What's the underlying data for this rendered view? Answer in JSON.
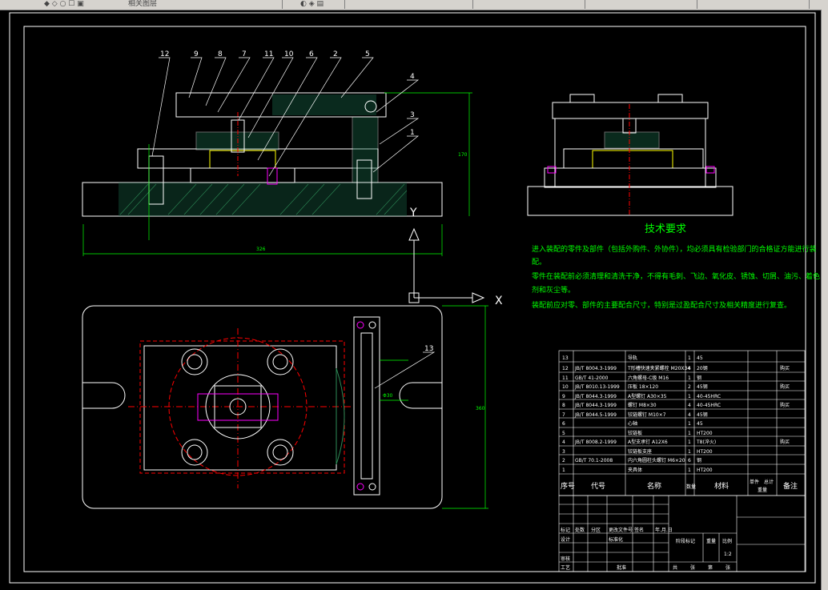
{
  "toolbar": {
    "layer_name": "相关图层"
  },
  "axes": {
    "x_label": "X",
    "y_label": "Y"
  },
  "tech_requirements": {
    "title": "技术要求",
    "lines": [
      "进入装配的零件及部件（包括外购件、外协件），均必须具有检验部门的合格证方能进行装",
      "配。",
      "零件在装配前必须清理和清洗干净，不得有毛刺、飞边、氧化皮、锈蚀、切屑、油污、着色",
      "剂和灰尘等。",
      "装配前应对零、部件的主要配合尺寸，特别是过盈配合尺寸及相关精度进行复查。"
    ]
  },
  "balloons": [
    "12",
    "9",
    "8",
    "7",
    "11",
    "10",
    "6",
    "2",
    "5",
    "4",
    "3",
    "1",
    "13"
  ],
  "bom": {
    "rows": [
      {
        "no": "13",
        "code": "",
        "name": "导轨",
        "qty": "1",
        "material": "45",
        "note": ""
      },
      {
        "no": "12",
        "code": "JB/T 8004.3-1999",
        "name": "T形槽快速夹紧螺栓 M20X34",
        "qty": "4",
        "material": "20钢",
        "note": "购买"
      },
      {
        "no": "11",
        "code": "GB/T 41-2000",
        "name": "六角螺母-C级 M16",
        "qty": "1",
        "material": "钢",
        "note": ""
      },
      {
        "no": "10",
        "code": "JB/T 8010.13-1999",
        "name": "压板 18×120",
        "qty": "2",
        "material": "45钢",
        "note": "购买"
      },
      {
        "no": "9",
        "code": "JB/T 8044.3-1999",
        "name": "A型螺钉 A30×35",
        "qty": "1",
        "material": "40-45HRC",
        "note": ""
      },
      {
        "no": "8",
        "code": "JB/T 8044.3-1999",
        "name": "螺钉 M8×30",
        "qty": "4",
        "material": "40-45HRC",
        "note": "购买"
      },
      {
        "no": "7",
        "code": "JB/T 8044.5-1999",
        "name": "铰链螺钉 M10×7",
        "qty": "4",
        "material": "45钢",
        "note": ""
      },
      {
        "no": "6",
        "code": "",
        "name": "心轴",
        "qty": "1",
        "material": "45",
        "note": ""
      },
      {
        "no": "5",
        "code": "",
        "name": "铰链板",
        "qty": "1",
        "material": "HT200",
        "note": ""
      },
      {
        "no": "4",
        "code": "JB/T 8008.2-1999",
        "name": "A型支承钉 A12X6",
        "qty": "1",
        "material": "T8(淬火)",
        "note": "购买"
      },
      {
        "no": "3",
        "code": "",
        "name": "铰链板支座",
        "qty": "1",
        "material": "HT200",
        "note": ""
      },
      {
        "no": "2",
        "code": "GB/T 70.1-2008",
        "name": "内六角圆柱头螺钉 M6×20",
        "qty": "6",
        "material": "钢",
        "note": ""
      },
      {
        "no": "1",
        "code": "",
        "name": "夹具体",
        "qty": "1",
        "material": "HT200",
        "note": ""
      }
    ],
    "headers": {
      "no": "序号",
      "code": "代号",
      "name": "名称",
      "qty": "数量",
      "material": "材料",
      "unit": "单件",
      "total": "总计",
      "weight": "重量",
      "note": "备注"
    }
  },
  "titleblock": {
    "labels": [
      "标记",
      "处数",
      "分区",
      "更改文件号",
      "签名",
      "年.月.日",
      "设计",
      "标准化",
      "阶段标记",
      "重量",
      "比例",
      "审核",
      "工艺",
      "批准",
      "共",
      "张",
      "第",
      "张"
    ],
    "scale": "1:2"
  },
  "dims": {
    "d1": "326",
    "d2": "170",
    "d3": "360",
    "d4": "Φ30"
  }
}
